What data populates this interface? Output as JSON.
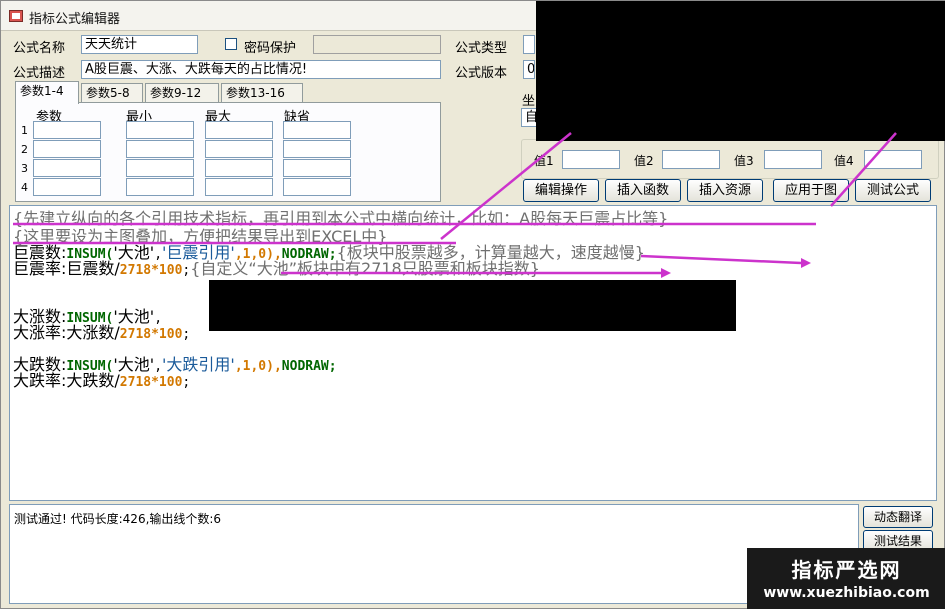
{
  "window": {
    "title": "指标公式编辑器"
  },
  "form": {
    "name_label": "公式名称",
    "name_value": "天天统计",
    "password_label": "密码保护",
    "desc_label": "公式描述",
    "desc_value": "A股巨震、大涨、大跌每天的占比情况!",
    "type_label": "公式类型",
    "version_label": "公式版本",
    "version_value": "0"
  },
  "tabs": [
    {
      "label": "参数1-4",
      "active": true
    },
    {
      "label": "参数5-8",
      "active": false
    },
    {
      "label": "参数9-12",
      "active": false
    },
    {
      "label": "参数13-16",
      "active": false
    }
  ],
  "params": {
    "headers": [
      "参数",
      "最小",
      "最大",
      "缺省"
    ],
    "rows": [
      "1",
      "2",
      "3",
      "4"
    ]
  },
  "coords": {
    "label_partial": "坐",
    "value_partial": "自"
  },
  "values_group": {
    "labels": [
      "值1",
      "值2",
      "值3",
      "值4"
    ]
  },
  "buttons": {
    "edit": "编辑操作",
    "insert_func": "插入函数",
    "insert_res": "插入资源",
    "apply_chart": "应用于图",
    "test_formula": "测试公式"
  },
  "code": {
    "line1": "{先建立纵向的各个引用技术指标，再引用到本公式中横向统计，比如：A股每天巨震占比等}",
    "line2": "{这里要设为主图叠加，方便把结果导出到EXCEL中}",
    "line3": {
      "var": "巨震数:",
      "fn": "INSUM(",
      "s1": "'大池'",
      "comma": ",",
      "s2": "'巨震引用'",
      "args": ",1,0),",
      "nodraw": "NODRAW;",
      "comment": "{板块中股票越多，计算量越大，速度越慢}"
    },
    "line4": {
      "var": "巨震率:巨震数/",
      "num": "2718*100",
      "semi": ";",
      "comment": "{自定义“大池”板块中有2718只股票和板块指数}"
    },
    "line5": {
      "var": "大涨数:",
      "fn": "INSUM(",
      "s1": "'大池'",
      "rest": ","
    },
    "line6": {
      "var": "大涨率:大涨数/",
      "num": "2718*100",
      "semi": ";"
    },
    "line7": {
      "var": "大跌数:",
      "fn": "INSUM(",
      "s1": "'大池'",
      "comma": ",",
      "s2": "'大跌引用'",
      "args": ",1,0),",
      "nodraw": "NODRAW;"
    },
    "line8": {
      "var": "大跌率:大跌数/",
      "num": "2718*100",
      "semi": ";"
    }
  },
  "output": {
    "status": "测试通过! 代码长度:426,输出线个数:6"
  },
  "side_buttons": {
    "dynamic": "动态翻译",
    "test_result": "测试结果"
  },
  "watermark": {
    "title": "指标严选网",
    "url": "www.xuezhibiao.com"
  },
  "colors": {
    "annotation": "#cc33cc",
    "window_bg": "#ece9d8"
  }
}
